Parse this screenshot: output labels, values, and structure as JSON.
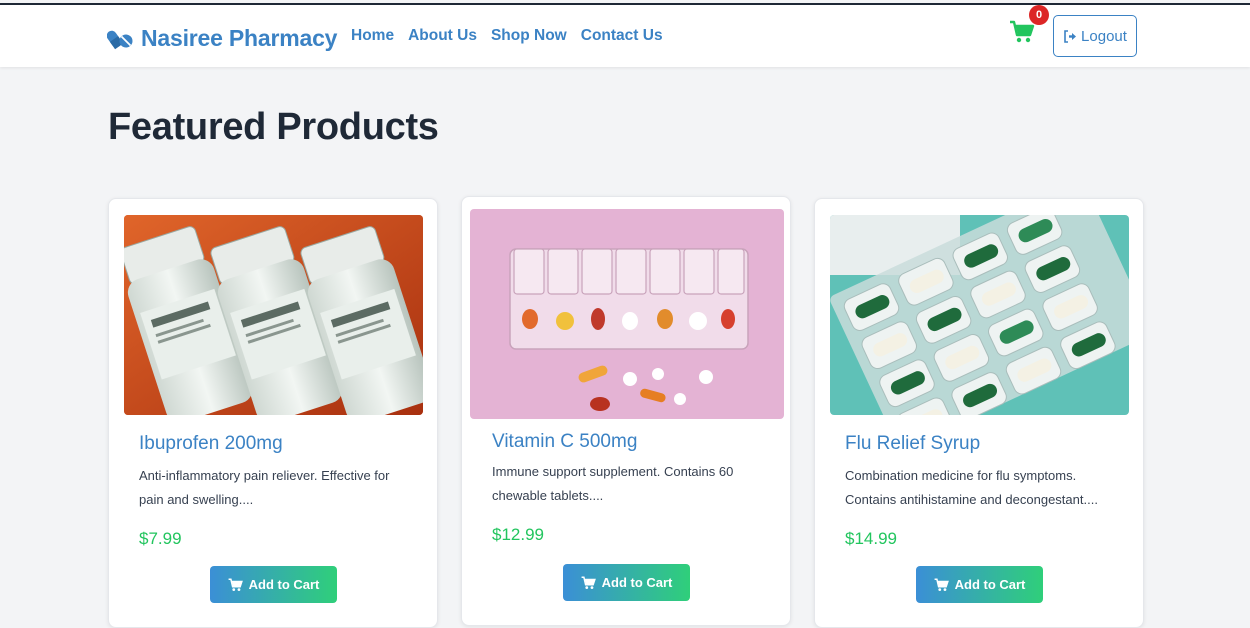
{
  "nav": {
    "brand": "Nasiree Pharmacy",
    "brand_icon": "pills-icon",
    "links": [
      "Home",
      "About Us",
      "Shop Now",
      "Contact Us"
    ],
    "cart_count": "0",
    "logout_label": "Logout",
    "accent": "#3b82c4"
  },
  "page": {
    "title": "Featured Products"
  },
  "products": [
    {
      "name": "Ibuprofen 200mg",
      "desc": "Anti-inflammatory pain reliever. Effective for pain and swelling....",
      "price": "$7.99",
      "button": "Add to Cart",
      "image": "supplement-bottles-on-orange"
    },
    {
      "name": "Vitamin C 500mg",
      "desc": "Immune support supplement. Contains 60 chewable tablets....",
      "price": "$12.99",
      "button": "Add to Cart",
      "image": "pill-organizer-on-pink"
    },
    {
      "name": "Flu Relief Syrup",
      "desc": "Combination medicine for flu symptoms. Contains antihistamine and decongestant....",
      "price": "$14.99",
      "button": "Add to Cart",
      "image": "capsule-blister-pack-on-teal"
    }
  ],
  "colors": {
    "price": "#22c55e",
    "badge": "#dc2626",
    "button_gradient_start": "#3b8fd6",
    "button_gradient_end": "#2fcf7a"
  }
}
